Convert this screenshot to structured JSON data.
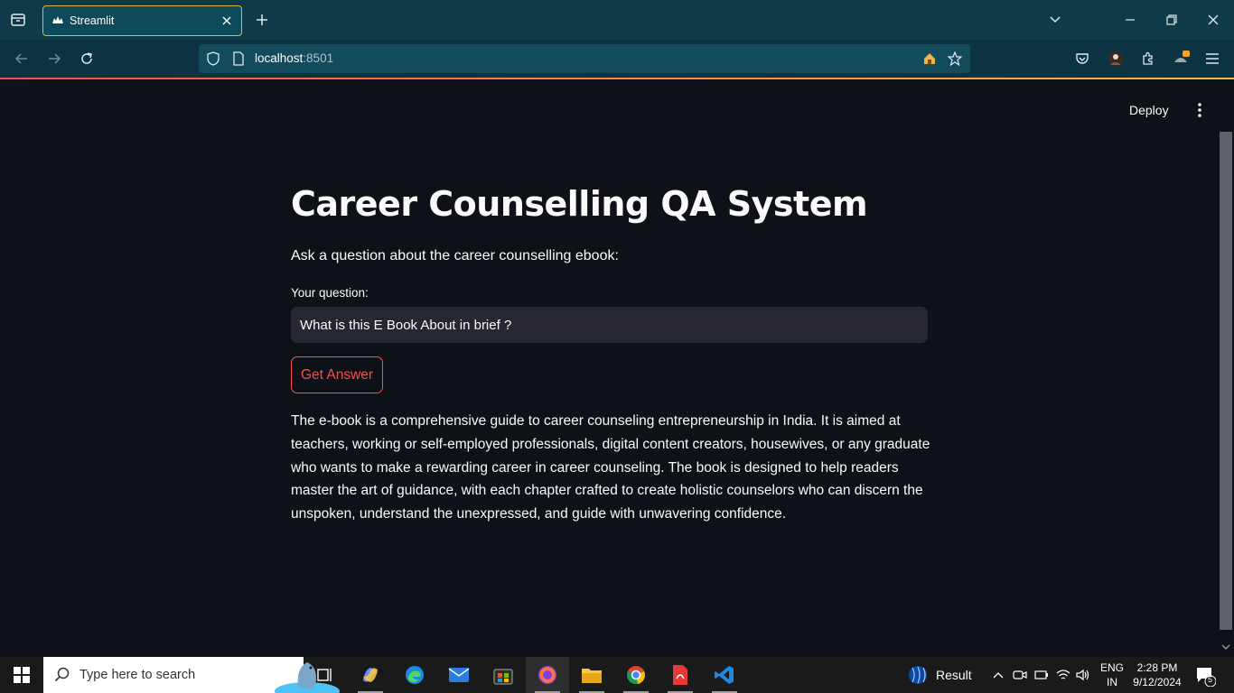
{
  "browser": {
    "tab_title": "Streamlit",
    "url_host": "localhost",
    "url_port": ":8501",
    "extension_badge": "1"
  },
  "app": {
    "deploy_label": "Deploy",
    "title": "Career Counselling QA System",
    "subtitle": "Ask a question about the career counselling ebook:",
    "question_label": "Your question:",
    "question_value": "What is this E Book About in brief ?",
    "button_label": "Get Answer",
    "answer": "The e-book is a comprehensive guide to career counseling entrepreneurship in India. It is aimed at teachers, working or self-employed professionals, digital content creators, housewives, or any graduate who wants to make a rewarding career in career counseling. The book is designed to help readers master the art of guidance, with each chapter crafted to create holistic counselors who can discern the unspoken, understand the unexpressed, and guide with unwavering confidence."
  },
  "taskbar": {
    "search_placeholder": "Type here to search",
    "result_label": "Result",
    "lang_line1": "ENG",
    "lang_line2": "IN",
    "time": "2:28 PM",
    "date": "9/12/2024",
    "notification_count": "5"
  },
  "colors": {
    "accent": "#ff4b4b",
    "background": "#0e1117",
    "input_bg": "#262730",
    "tab_border": "#e0b93a"
  }
}
